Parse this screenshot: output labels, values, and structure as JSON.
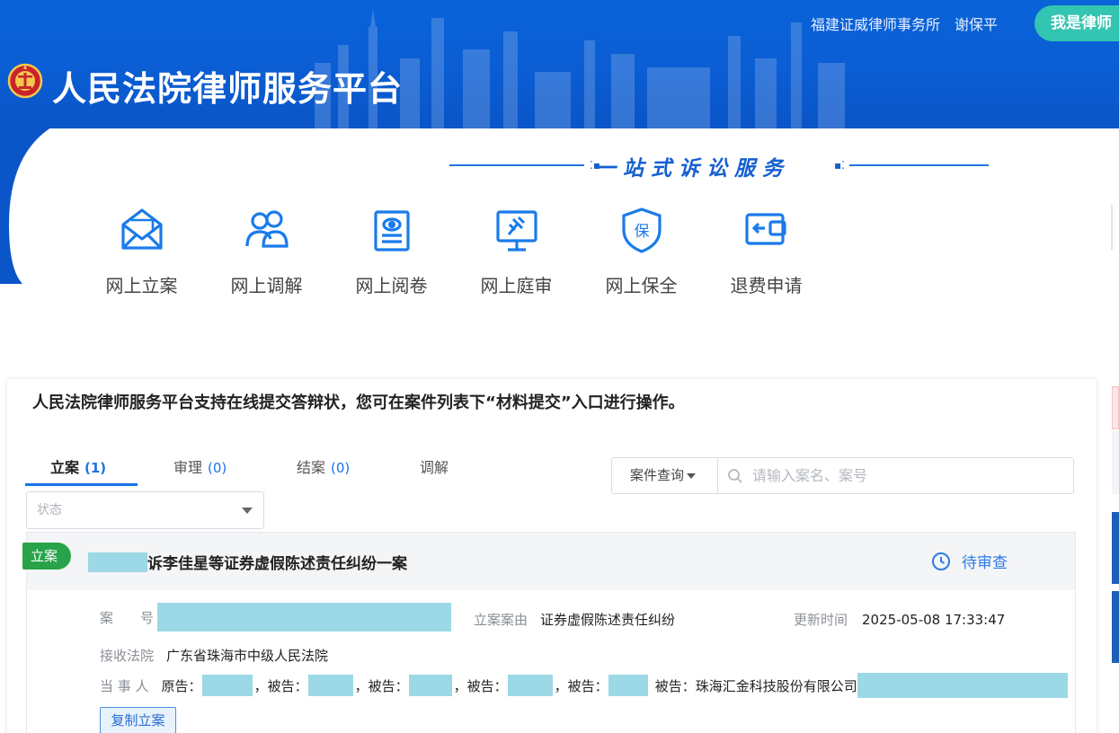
{
  "header": {
    "firm": "福建证威律师事务所",
    "user": "谢保平",
    "lawyer_button": "我是律师",
    "title": "人民法院律师服务平台"
  },
  "slogan": "一站式诉讼服务",
  "services": [
    {
      "label": "网上立案",
      "icon": "mail-envelope-icon"
    },
    {
      "label": "网上调解",
      "icon": "people-icon"
    },
    {
      "label": "网上阅卷",
      "icon": "document-view-icon"
    },
    {
      "label": "网上庭审",
      "icon": "court-gavel-icon"
    },
    {
      "label": "网上保全",
      "icon": "shield-bao-icon"
    },
    {
      "label": "退费申请",
      "icon": "refund-wallet-icon"
    }
  ],
  "notice": "人民法院律师服务平台支持在线提交答辩状，您可在案件列表下“材料提交”入口进行操作。",
  "tabs": [
    {
      "label": "立案",
      "count": "(1)"
    },
    {
      "label": "审理",
      "count": "(0)"
    },
    {
      "label": "结案",
      "count": "(0)"
    },
    {
      "label": "调解",
      "count": ""
    }
  ],
  "search": {
    "type": "案件查询",
    "placeholder": "请输入案名、案号"
  },
  "status_filter": {
    "placeholder": "状态"
  },
  "case": {
    "tag": "立案",
    "title": "诉李佳星等证券虚假陈述责任纠纷一案",
    "status": "待审查",
    "case_no_label": "案　　号",
    "cause_label": "立案案由",
    "cause": "证券虚假陈述责任纠纷",
    "updated_label": "更新时间",
    "updated": "2025-05-08 17:33:47",
    "court_label": "接收法院",
    "court": "广东省珠海市中级人民法院",
    "parties_label": "当 事 人",
    "plaintiff_prefix": "原告：",
    "defendant_prefix": "被告：",
    "last_defendant": "珠海汇金科技股份有限公司",
    "copy_button": "复制立案"
  },
  "colors": {
    "header_blue": "#0a5fd6",
    "accent": "#1a73e8",
    "lawyer_button": "#34c5b2",
    "case_tag": "#29a34a",
    "redaction": "#9cd8e6"
  }
}
